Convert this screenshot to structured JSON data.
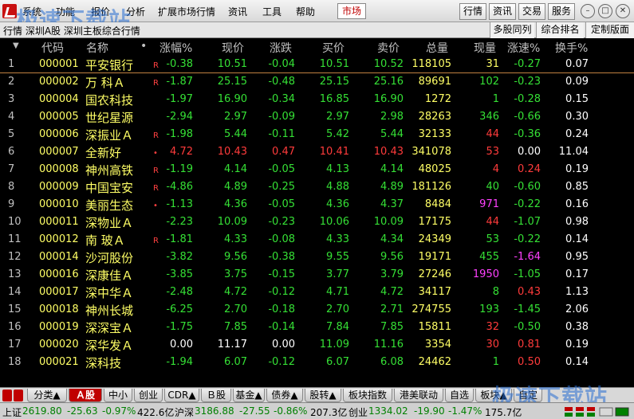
{
  "menubar": {
    "items": [
      "系统",
      "功能",
      "报价",
      "分析",
      "扩展市场行情",
      "资讯",
      "工具",
      "帮助"
    ],
    "active": "市场",
    "right_buttons": [
      "行情",
      "资讯",
      "交易",
      "服务"
    ],
    "window_controls": [
      "minimize-icon",
      "restore-icon",
      "close-icon"
    ]
  },
  "watermark": "极速下载站",
  "subbar": {
    "left": "行情   深圳A股  深圳主板综合行情",
    "buttons": [
      "多股同列",
      "综合排名",
      "定制版面"
    ]
  },
  "table": {
    "headers": [
      "代码",
      "名称",
      "•",
      "涨幅%",
      "现价",
      "涨跌",
      "买价",
      "卖价",
      "总量",
      "现量",
      "涨速%",
      "换手%"
    ],
    "rows": [
      {
        "idx": "1",
        "code": "000001",
        "name": "平安银行",
        "flag": "R",
        "chg_pct": "-0.38",
        "price": "10.51",
        "chg": "-0.04",
        "bid": "10.51",
        "ask": "10.52",
        "vol": "118105",
        "cur": "31",
        "speed": "-0.27",
        "turn": "0.07",
        "dir": "dn",
        "cur_c": "yl",
        "speed_c": "dn"
      },
      {
        "idx": "2",
        "code": "000002",
        "name": "万 科Ａ",
        "flag": "R",
        "chg_pct": "-1.87",
        "price": "25.15",
        "chg": "-0.48",
        "bid": "25.15",
        "ask": "25.16",
        "vol": "89691",
        "cur": "102",
        "speed": "-0.23",
        "turn": "0.09",
        "dir": "dn",
        "cur_c": "dn",
        "speed_c": "dn"
      },
      {
        "idx": "3",
        "code": "000004",
        "name": "国农科技",
        "flag": "",
        "chg_pct": "-1.97",
        "price": "16.90",
        "chg": "-0.34",
        "bid": "16.85",
        "ask": "16.90",
        "vol": "1272",
        "cur": "1",
        "speed": "-0.28",
        "turn": "0.15",
        "dir": "dn",
        "cur_c": "dn",
        "speed_c": "dn"
      },
      {
        "idx": "4",
        "code": "000005",
        "name": "世纪星源",
        "flag": "",
        "chg_pct": "-2.94",
        "price": "2.97",
        "chg": "-0.09",
        "bid": "2.97",
        "ask": "2.98",
        "vol": "28263",
        "cur": "346",
        "speed": "-0.66",
        "turn": "0.30",
        "dir": "dn",
        "cur_c": "dn",
        "speed_c": "dn"
      },
      {
        "idx": "5",
        "code": "000006",
        "name": "深振业Ａ",
        "flag": "R",
        "chg_pct": "-1.98",
        "price": "5.44",
        "chg": "-0.11",
        "bid": "5.42",
        "ask": "5.44",
        "vol": "32133",
        "cur": "44",
        "speed": "-0.36",
        "turn": "0.24",
        "dir": "dn",
        "cur_c": "up",
        "speed_c": "dn"
      },
      {
        "idx": "6",
        "code": "000007",
        "name": "全新好",
        "flag": "•",
        "chg_pct": "4.72",
        "price": "10.43",
        "chg": "0.47",
        "bid": "10.41",
        "ask": "10.43",
        "vol": "341078",
        "cur": "53",
        "speed": "0.00",
        "turn": "11.04",
        "dir": "up",
        "cur_c": "up",
        "speed_c": "eq"
      },
      {
        "idx": "7",
        "code": "000008",
        "name": "神州高铁",
        "flag": "R",
        "chg_pct": "-1.19",
        "price": "4.14",
        "chg": "-0.05",
        "bid": "4.13",
        "ask": "4.14",
        "vol": "48025",
        "cur": "4",
        "speed": "0.24",
        "turn": "0.19",
        "dir": "dn",
        "cur_c": "up",
        "speed_c": "up"
      },
      {
        "idx": "8",
        "code": "000009",
        "name": "中国宝安",
        "flag": "R",
        "chg_pct": "-4.86",
        "price": "4.89",
        "chg": "-0.25",
        "bid": "4.88",
        "ask": "4.89",
        "vol": "181126",
        "cur": "40",
        "speed": "-0.60",
        "turn": "0.85",
        "dir": "dn",
        "cur_c": "dn",
        "speed_c": "dn"
      },
      {
        "idx": "9",
        "code": "000010",
        "name": "美丽生态",
        "flag": "•",
        "chg_pct": "-1.13",
        "price": "4.36",
        "chg": "-0.05",
        "bid": "4.36",
        "ask": "4.37",
        "vol": "8484",
        "cur": "971",
        "speed": "-0.22",
        "turn": "0.16",
        "dir": "dn",
        "cur_c": "mg",
        "speed_c": "dn"
      },
      {
        "idx": "10",
        "code": "000011",
        "name": "深物业Ａ",
        "flag": "",
        "chg_pct": "-2.23",
        "price": "10.09",
        "chg": "-0.23",
        "bid": "10.06",
        "ask": "10.09",
        "vol": "17175",
        "cur": "44",
        "speed": "-1.07",
        "turn": "0.98",
        "dir": "dn",
        "cur_c": "up",
        "speed_c": "dn"
      },
      {
        "idx": "11",
        "code": "000012",
        "name": "南 玻Ａ",
        "flag": "R",
        "chg_pct": "-1.81",
        "price": "4.33",
        "chg": "-0.08",
        "bid": "4.33",
        "ask": "4.34",
        "vol": "24349",
        "cur": "53",
        "speed": "-0.22",
        "turn": "0.14",
        "dir": "dn",
        "cur_c": "dn",
        "speed_c": "dn"
      },
      {
        "idx": "12",
        "code": "000014",
        "name": "沙河股份",
        "flag": "",
        "chg_pct": "-3.82",
        "price": "9.56",
        "chg": "-0.38",
        "bid": "9.55",
        "ask": "9.56",
        "vol": "19171",
        "cur": "455",
        "speed": "-1.64",
        "turn": "0.95",
        "dir": "dn",
        "cur_c": "dn",
        "speed_c": "mg"
      },
      {
        "idx": "13",
        "code": "000016",
        "name": "深康佳Ａ",
        "flag": "",
        "chg_pct": "-3.85",
        "price": "3.75",
        "chg": "-0.15",
        "bid": "3.77",
        "ask": "3.79",
        "vol": "27246",
        "cur": "1950",
        "speed": "-1.05",
        "turn": "0.17",
        "dir": "dn",
        "cur_c": "mg",
        "speed_c": "dn"
      },
      {
        "idx": "14",
        "code": "000017",
        "name": "深中华Ａ",
        "flag": "",
        "chg_pct": "-2.48",
        "price": "4.72",
        "chg": "-0.12",
        "bid": "4.71",
        "ask": "4.72",
        "vol": "34117",
        "cur": "8",
        "speed": "0.43",
        "turn": "1.13",
        "dir": "dn",
        "cur_c": "dn",
        "speed_c": "up"
      },
      {
        "idx": "15",
        "code": "000018",
        "name": "神州长城",
        "flag": "",
        "chg_pct": "-6.25",
        "price": "2.70",
        "chg": "-0.18",
        "bid": "2.70",
        "ask": "2.71",
        "vol": "274755",
        "cur": "193",
        "speed": "-1.45",
        "turn": "2.06",
        "dir": "dn",
        "cur_c": "dn",
        "speed_c": "dn"
      },
      {
        "idx": "16",
        "code": "000019",
        "name": "深深宝Ａ",
        "flag": "",
        "chg_pct": "-1.75",
        "price": "7.85",
        "chg": "-0.14",
        "bid": "7.84",
        "ask": "7.85",
        "vol": "15811",
        "cur": "32",
        "speed": "-0.50",
        "turn": "0.38",
        "dir": "dn",
        "cur_c": "up",
        "speed_c": "dn"
      },
      {
        "idx": "17",
        "code": "000020",
        "name": "深华发Ａ",
        "flag": "",
        "chg_pct": "0.00",
        "price": "11.17",
        "chg": "0.00",
        "bid": "11.09",
        "ask": "11.16",
        "vol": "3354",
        "cur": "30",
        "speed": "0.81",
        "turn": "0.19",
        "dir": "eq",
        "cur_c": "up",
        "speed_c": "up",
        "bid_c": "dn",
        "ask_c": "dn"
      },
      {
        "idx": "18",
        "code": "000021",
        "name": "深科技",
        "flag": "",
        "chg_pct": "-1.94",
        "price": "6.07",
        "chg": "-0.12",
        "bid": "6.07",
        "ask": "6.08",
        "vol": "24462",
        "cur": "1",
        "speed": "0.50",
        "turn": "0.14",
        "dir": "dn",
        "cur_c": "dn",
        "speed_c": "up"
      }
    ]
  },
  "tabs": [
    "分类▲",
    "Ａ股",
    "中小",
    "创业",
    "CDR▲",
    "Ｂ股",
    "基金▲",
    "债券▲",
    "股转▲",
    "板块指数",
    "港美联动",
    "自选",
    "板块▲",
    "自定"
  ],
  "active_tab": "Ａ股",
  "status": {
    "sh_label": "上证",
    "sh_value": "2619.80",
    "sh_chg": "-25.63",
    "sh_pct": "-0.97%",
    "sh_amt": "422.6亿",
    "sz_label": "沪深",
    "sz_value": "3186.88",
    "sz_chg": "-27.55",
    "sz_pct": "-0.86%",
    "sz_amt": "207.3亿",
    "cy_label": "创业",
    "cy_value": "1334.02",
    "cy_chg": "-19.90",
    "cy_pct": "-1.47%",
    "cy_amt": "175.7亿"
  },
  "colors": {
    "up": "#ff3b3b",
    "down": "#35e035",
    "code": "#ffff66",
    "accent": "#c00000"
  }
}
